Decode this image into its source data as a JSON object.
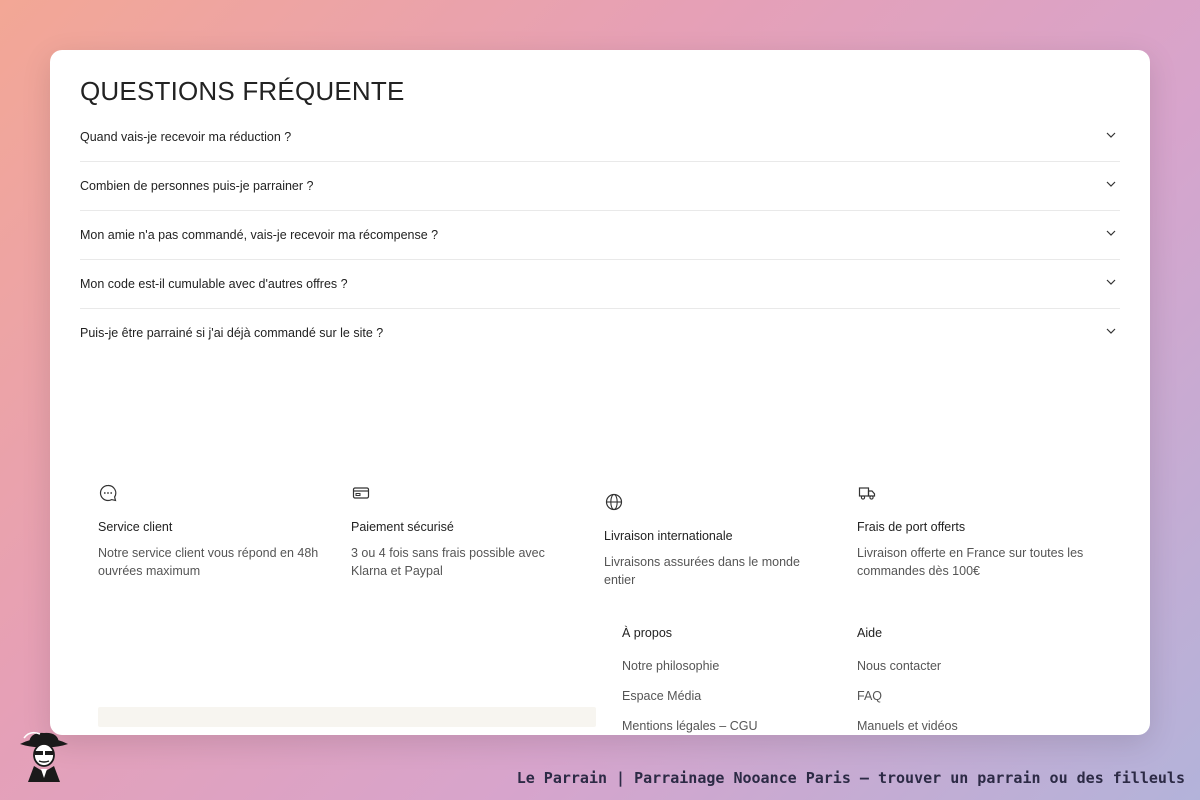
{
  "faq": {
    "title": "QUESTIONS FRÉQUENTE",
    "items": [
      {
        "question": "Quand vais-je recevoir ma réduction ?"
      },
      {
        "question": "Combien de personnes puis-je parrainer ?"
      },
      {
        "question": "Mon amie n'a pas commandé, vais-je recevoir ma récompense ?"
      },
      {
        "question": "Mon code est-il cumulable avec d'autres offres ?"
      },
      {
        "question": "Puis-je être parrainé si j'ai déjà commandé sur le site ?"
      }
    ]
  },
  "features": [
    {
      "icon": "chat-bubble-icon",
      "title": "Service client",
      "description": "Notre service client vous répond en 48h ouvrées maximum"
    },
    {
      "icon": "credit-card-icon",
      "title": "Paiement sécurisé",
      "description": "3 ou 4 fois sans frais possible avec Klarna et Paypal"
    },
    {
      "icon": "globe-icon",
      "title": "Livraison internationale",
      "description": "Livraisons assurées dans le monde entier"
    },
    {
      "icon": "truck-icon",
      "title": "Frais de port offerts",
      "description": "Livraison offerte en France sur toutes les commandes dès 100€"
    }
  ],
  "footer": {
    "apropos": {
      "heading": "À propos",
      "links": [
        "Notre philosophie",
        "Espace Média",
        "Mentions légales – CGU"
      ]
    },
    "aide": {
      "heading": "Aide",
      "links": [
        "Nous contacter",
        "FAQ",
        "Manuels et vidéos"
      ]
    }
  },
  "watermark": "Le Parrain | Parrainage Nooance Paris — trouver un parrain ou des filleuls",
  "colors": {
    "text": "#222222",
    "muted": "#555555",
    "divider": "#e9e9e9",
    "card": "#ffffff",
    "watermark": "#2c2a45"
  }
}
